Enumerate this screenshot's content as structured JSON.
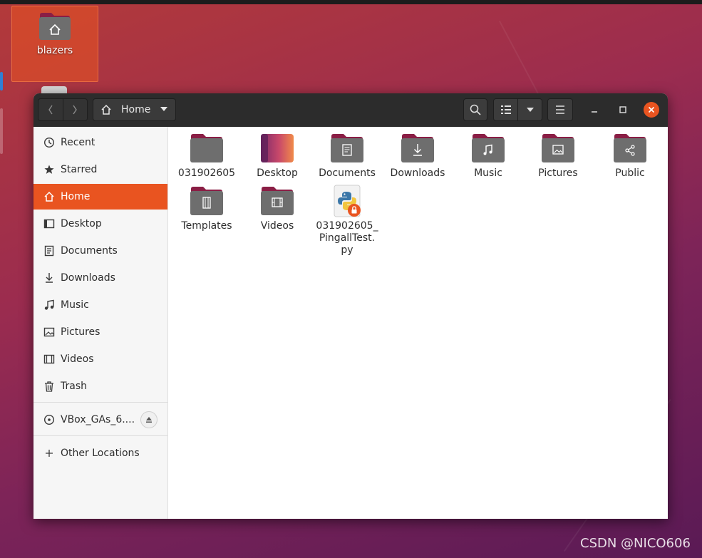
{
  "desktop": {
    "home_icon_label": "blazers",
    "watermark": "CSDN @NICO606"
  },
  "window": {
    "header": {
      "path_label": "Home",
      "back_icon": "chevron-left-icon",
      "forward_icon": "chevron-right-icon"
    },
    "sidebar": {
      "items": [
        {
          "label": "Recent",
          "icon": "clock-icon"
        },
        {
          "label": "Starred",
          "icon": "star-icon"
        },
        {
          "label": "Home",
          "icon": "home-icon",
          "active": true
        },
        {
          "label": "Desktop",
          "icon": "desktop-icon"
        },
        {
          "label": "Documents",
          "icon": "document-icon"
        },
        {
          "label": "Downloads",
          "icon": "download-icon"
        },
        {
          "label": "Music",
          "icon": "music-icon"
        },
        {
          "label": "Pictures",
          "icon": "picture-icon"
        },
        {
          "label": "Videos",
          "icon": "video-icon"
        },
        {
          "label": "Trash",
          "icon": "trash-icon"
        }
      ],
      "device": {
        "label": "VBox_GAs_6....",
        "icon": "disc-icon"
      },
      "other_locations": {
        "label": "Other Locations",
        "icon": "plus-icon"
      }
    },
    "files": [
      {
        "label": "031902605",
        "emblem": "none"
      },
      {
        "label": "Desktop",
        "emblem": "desktop"
      },
      {
        "label": "Documents",
        "emblem": "document"
      },
      {
        "label": "Downloads",
        "emblem": "download"
      },
      {
        "label": "Music",
        "emblem": "music"
      },
      {
        "label": "Pictures",
        "emblem": "picture"
      },
      {
        "label": "Public",
        "emblem": "share"
      },
      {
        "label": "Templates",
        "emblem": "template"
      },
      {
        "label": "Videos",
        "emblem": "video"
      },
      {
        "label_lines": [
          "031902605_",
          "PingallTest.",
          "py"
        ],
        "emblem": "python-locked"
      }
    ]
  },
  "colors": {
    "accent": "#e95420",
    "headerbar": "#2c2c2c",
    "sidebar_bg": "#f6f6f6",
    "folder_tab": "#8a1e45",
    "folder_body": "#6e6e6e"
  }
}
